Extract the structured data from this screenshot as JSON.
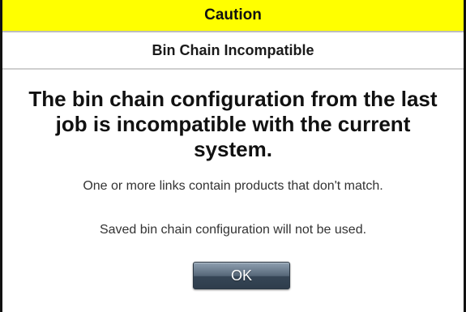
{
  "dialog": {
    "caption": "Caution",
    "subtitle": "Bin Chain Incompatible",
    "headline": "The bin chain configuration from the last job is incompatible with the current system.",
    "messages": [
      "One or more links contain products that don't match.",
      "Saved bin chain configuration will not be used."
    ],
    "ok_label": "OK"
  },
  "colors": {
    "caption_background": "#ffff00",
    "button_gradient_top": "#8fa0b1",
    "button_gradient_bottom": "#2f3d4c"
  }
}
